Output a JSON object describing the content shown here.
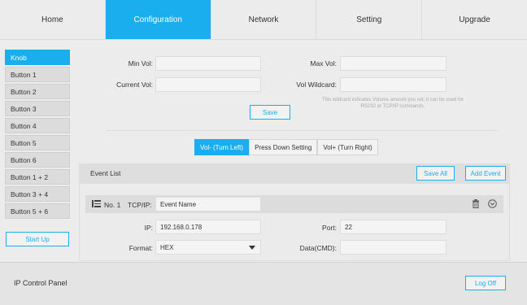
{
  "nav": {
    "tabs": [
      {
        "label": "Home"
      },
      {
        "label": "Configuration"
      },
      {
        "label": "Network"
      },
      {
        "label": "Setting"
      },
      {
        "label": "Upgrade"
      }
    ]
  },
  "sidebar": {
    "items": [
      {
        "label": "Knob"
      },
      {
        "label": "Button 1"
      },
      {
        "label": "Button 2"
      },
      {
        "label": "Button 3"
      },
      {
        "label": "Button 4"
      },
      {
        "label": "Button 5"
      },
      {
        "label": "Button 6"
      },
      {
        "label": "Button 1 + 2"
      },
      {
        "label": "Button 3 + 4"
      },
      {
        "label": "Button 5 + 6"
      }
    ],
    "startup_label": "Start Up"
  },
  "vol": {
    "min_label": "Min Vol:",
    "max_label": "Max Vol:",
    "current_label": "Current Vol:",
    "wildcard_label": "Vol Wildcard:",
    "hint": "This wildcard indicates Volume amount you set, it can be used for RS232 or TCP/IP commands.",
    "save_label": "Save"
  },
  "segments": {
    "left": "Vol- (Turn Left)",
    "press": "Press Down Setting",
    "right": "Vol+ (Turn Right)"
  },
  "events": {
    "title": "Event List",
    "save_all_label": "Save All",
    "add_event_label": "Add Event",
    "row": {
      "number": "No. 1",
      "type": "TCP/IP:",
      "name_value": "Event Name",
      "ip_label": "IP:",
      "ip_value": "192.168.0.178",
      "port_label": "Port:",
      "port_value": "22",
      "format_label": "Format:",
      "format_value": "HEX",
      "data_label": "Data(CMD):"
    }
  },
  "footer": {
    "title": "IP Control Panel",
    "logoff_label": "Log Off"
  },
  "colors": {
    "accent": "#1aaeef"
  }
}
